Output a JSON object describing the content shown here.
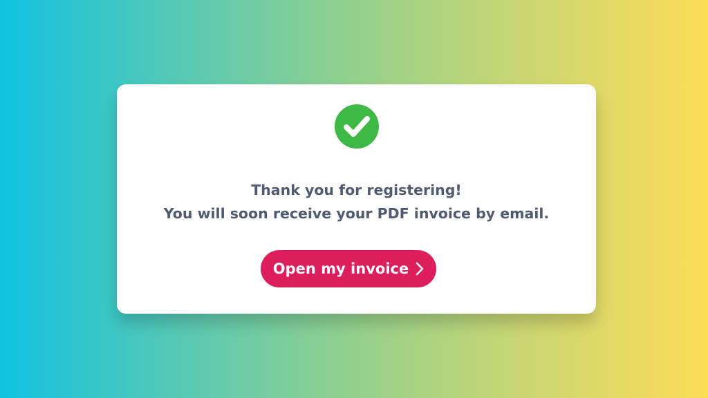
{
  "message": {
    "line1": "Thank you for registering!",
    "line2": "You will soon receive your PDF invoice by email."
  },
  "button": {
    "label": "Open my invoice",
    "icon": "chevron-right-icon"
  },
  "status_icon": "check-circle-icon",
  "colors": {
    "gradient_start": "#10c3e0",
    "gradient_end": "#fddc58",
    "success": "#3fb945",
    "button": "#dc1e5c",
    "text": "#505a70"
  }
}
